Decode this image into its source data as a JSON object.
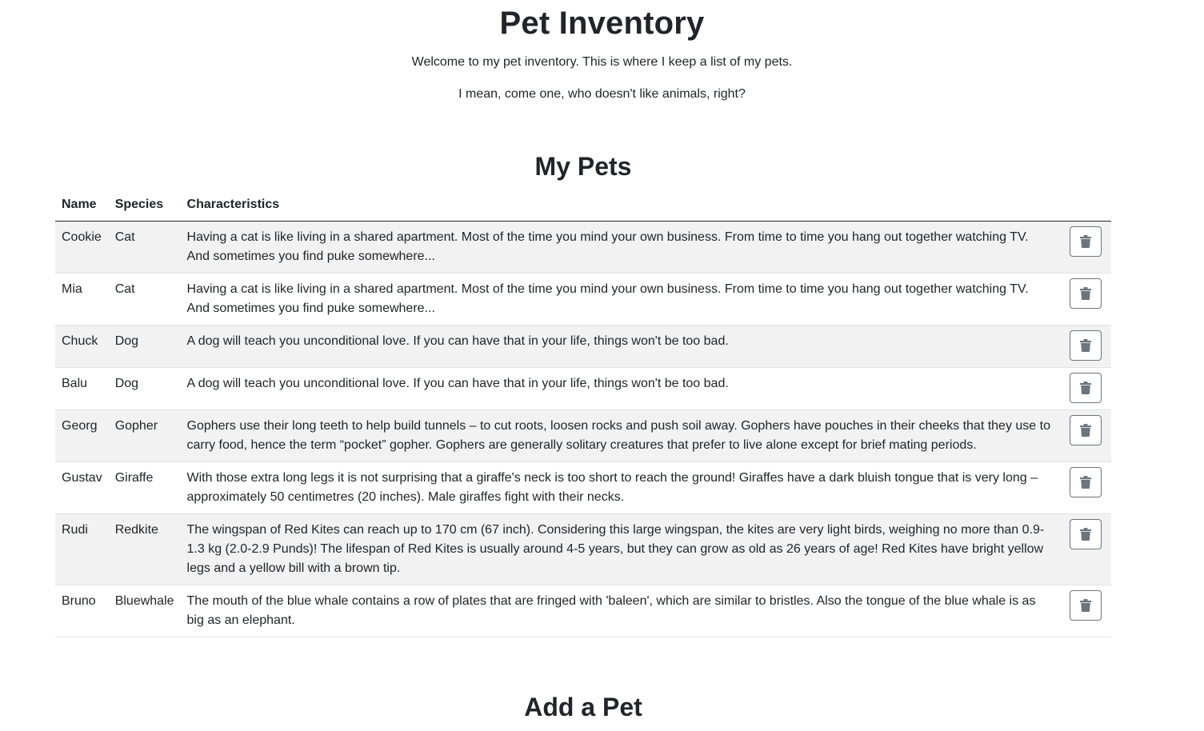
{
  "header": {
    "title": "Pet Inventory",
    "intro1": "Welcome to my pet inventory. This is where I keep a list of my pets.",
    "intro2": "I mean, come one, who doesn't like animals, right?"
  },
  "pets_section": {
    "title": "My Pets",
    "columns": [
      "Name",
      "Species",
      "Characteristics"
    ],
    "rows": [
      {
        "name": "Cookie",
        "species": "Cat",
        "characteristics": "Having a cat is like living in a shared apartment. Most of the time you mind your own business. From time to time you hang out together watching TV. And sometimes you find puke somewhere...",
        "action_icon": "trash-icon"
      },
      {
        "name": "Mia",
        "species": "Cat",
        "characteristics": "Having a cat is like living in a shared apartment. Most of the time you mind your own business. From time to time you hang out together watching TV. And sometimes you find puke somewhere...",
        "action_icon": "trash-icon"
      },
      {
        "name": "Chuck",
        "species": "Dog",
        "characteristics": "A dog will teach you unconditional love. If you can have that in your life, things won't be too bad.",
        "action_icon": "trash-icon"
      },
      {
        "name": "Balu",
        "species": "Dog",
        "characteristics": "A dog will teach you unconditional love. If you can have that in your life, things won't be too bad.",
        "action_icon": "trash-icon"
      },
      {
        "name": "Georg",
        "species": "Gopher",
        "characteristics": "Gophers use their long teeth to help build tunnels – to cut roots, loosen rocks and push soil away. Gophers have pouches in their cheeks that they use to carry food, hence the term “pocket” gopher. Gophers are generally solitary creatures that prefer to live alone except for brief mating periods.",
        "action_icon": "trash-icon"
      },
      {
        "name": "Gustav",
        "species": "Giraffe",
        "characteristics": "With those extra long legs it is not surprising that a giraffe's neck is too short to reach the ground! Giraffes have a dark bluish tongue that is very long – approximately 50 centimetres (20 inches). Male giraffes fight with their necks.",
        "action_icon": "trash-icon"
      },
      {
        "name": "Rudi",
        "species": "Redkite",
        "characteristics": "The wingspan of Red Kites can reach up to 170 cm (67 inch). Considering this large wingspan, the kites are very light birds, weighing no more than 0.9-1.3 kg (2.0-2.9 Punds)! The lifespan of Red Kites is usually around 4-5 years, but they can grow as old as 26 years of age! Red Kites have bright yellow legs and a yellow bill with a brown tip.",
        "action_icon": "trash-icon"
      },
      {
        "name": "Bruno",
        "species": "Bluewhale",
        "characteristics": "The mouth of the blue whale contains a row of plates that are fringed with 'baleen', which are similar to bristles. Also the tongue of the blue whale is as big as an elephant.",
        "action_icon": "trash-icon"
      }
    ]
  },
  "add_section": {
    "title": "Add a Pet"
  },
  "colors": {
    "text": "#212529",
    "stripe": "#f2f2f2",
    "button_border": "#6c757d",
    "icon": "#6c757d"
  }
}
